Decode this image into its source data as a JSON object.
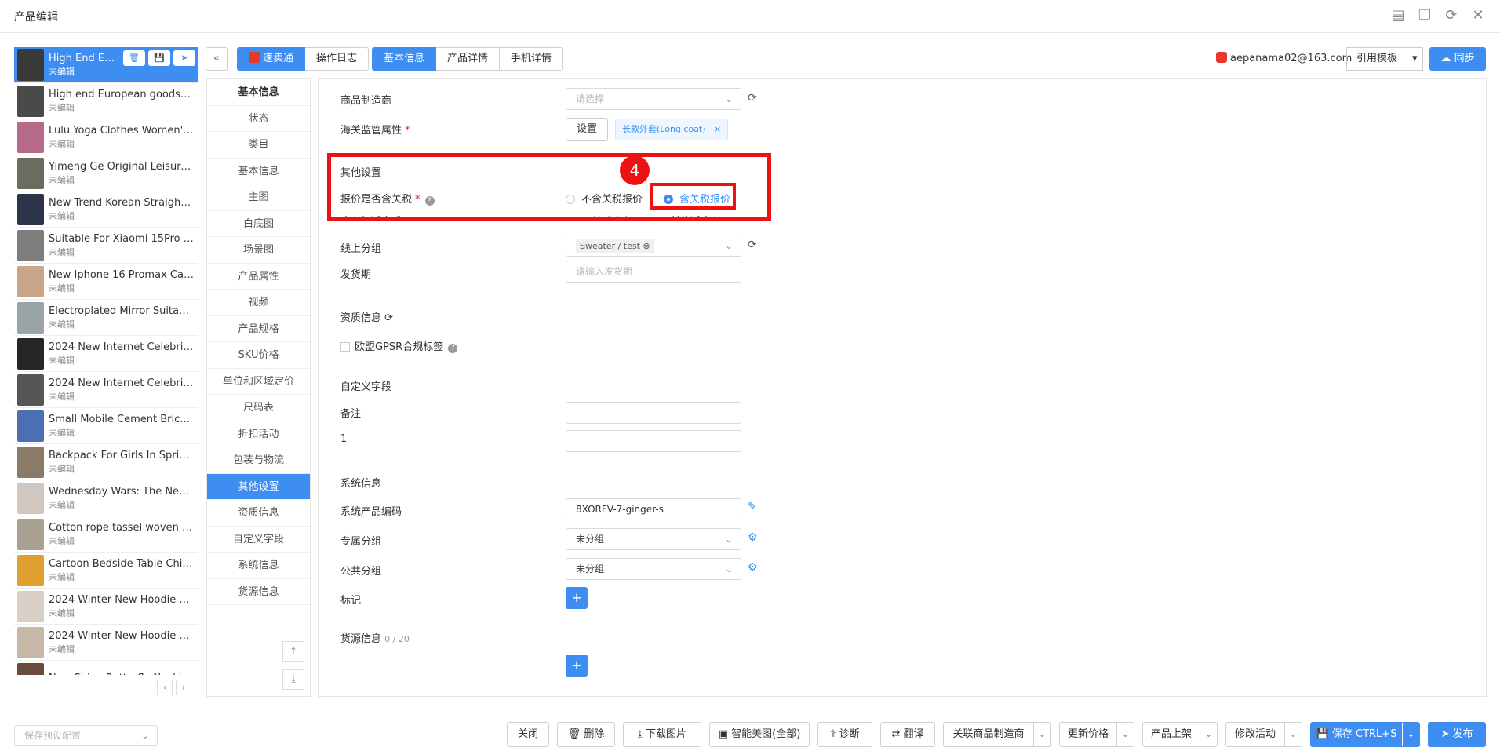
{
  "window": {
    "title": "产品编辑"
  },
  "products": [
    {
      "name": "High End Europ...",
      "status": "未编辑",
      "color": "#3a3a3a"
    },
    {
      "name": "High end European goods, hig...",
      "status": "未编辑",
      "color": "#4a4a4a"
    },
    {
      "name": "Lulu Yoga Clothes Women's S...",
      "status": "未编辑",
      "color": "#b66a8a"
    },
    {
      "name": "Yimeng Ge Original Leisure Ti...",
      "status": "未编辑",
      "color": "#6b6b5f"
    },
    {
      "name": "New Trend Korean Straight Le...",
      "status": "未编辑",
      "color": "#2d3348"
    },
    {
      "name": "Suitable For Xiaomi 15Pro Ph...",
      "status": "未编辑",
      "color": "#7d7d7d"
    },
    {
      "name": "New Iphone 16 Promax Case ...",
      "status": "未编辑",
      "color": "#c9a58a"
    },
    {
      "name": "Electroplated Mirror Suitable F...",
      "status": "未编辑",
      "color": "#9aa3a8"
    },
    {
      "name": "2024 New Internet Celebrity S...",
      "status": "未编辑",
      "color": "#262626"
    },
    {
      "name": "2024 New Internet Celebrity S...",
      "status": "未编辑",
      "color": "#555555"
    },
    {
      "name": "Small Mobile Cement Brick M...",
      "status": "未编辑",
      "color": "#4b6fb0"
    },
    {
      "name": "Backpack For Girls In Spring, ...",
      "status": "未编辑",
      "color": "#8a7a68"
    },
    {
      "name": "Wednesday Wars: The Newbe...",
      "status": "未编辑",
      "color": "#d0c7c0"
    },
    {
      "name": "Cotton rope tassel woven bag,...",
      "status": "未编辑",
      "color": "#a8a090"
    },
    {
      "name": "Cartoon Bedside Table Childre...",
      "status": "未编辑",
      "color": "#e0a030"
    },
    {
      "name": "2024 Winter New Hoodie Loos...",
      "status": "未编辑",
      "color": "#d8cfc6"
    },
    {
      "name": "2024 Winter New Hoodie Loos...",
      "status": "未编辑",
      "color": "#c8b8a8"
    },
    {
      "name": "New Shiny Butterfly Necklace ...",
      "status": "",
      "color": "#6a4a3a"
    }
  ],
  "toolbar": {
    "collapse": "«",
    "platform_tabs": [
      "速卖通",
      "操作日志"
    ],
    "content_tabs": [
      "基本信息",
      "产品详情",
      "手机详情"
    ],
    "account": "aepanama02@163.com",
    "template_label": "引用模板",
    "template_caret": "▾",
    "sync_label": "同步"
  },
  "anchor_nav": {
    "items": [
      "基本信息",
      "状态",
      "类目",
      "基本信息",
      "主图",
      "白底图",
      "场景图",
      "产品属性",
      "视频",
      "产品规格",
      "SKU价格",
      "单位和区域定价",
      "尺码表",
      "折扣活动",
      "包装与物流",
      "其他设置",
      "资质信息",
      "自定义字段",
      "系统信息",
      "货源信息"
    ],
    "to_top": "⤒",
    "to_bottom": "⤓"
  },
  "form": {
    "manufacturer_label": "商品制造商",
    "manufacturer_placeholder": "请选择",
    "customs_label": "海关监管属性",
    "customs_button": "设置",
    "customs_tag": "长款外套(Long coat)",
    "customs_tag_close": "×",
    "other_settings_title": "其他设置",
    "tax_label": "报价是否含关税",
    "tax_option_excl": "不含关税报价",
    "tax_option_incl": "含关税报价",
    "stock_label": "库存扣减方式",
    "stock_option_1": "下单减库存",
    "stock_option_2": "付款减库存",
    "online_group_label": "线上分组",
    "online_group_value": "Sweater / test",
    "ship_label": "发货期",
    "ship_placeholder": "请输入发货期",
    "qualification_title": "资质信息",
    "gpsr_label": "欧盟GPSR合规标签",
    "custom_title": "自定义字段",
    "remark_label": "备注",
    "field1_label": "1",
    "system_title": "系统信息",
    "sys_code_label": "系统产品编码",
    "sys_code_value": "8XORFV-7-ginger-s",
    "private_group_label": "专属分组",
    "private_group_value": "未分组",
    "public_group_label": "公共分组",
    "public_group_value": "未分组",
    "tag_label": "标记",
    "source_title": "货源信息",
    "source_count": "0 / 20",
    "step_number": "4"
  },
  "footer": {
    "preset_placeholder": "保存预设配置",
    "close": "关闭",
    "delete": "删除",
    "download": "下载图片",
    "beautify": "智能美图(全部)",
    "diagnose": "诊断",
    "translate": "翻译",
    "link_maker": "关联商品制造商",
    "update_price": "更新价格",
    "list_product": "产品上架",
    "modify_activity": "修改活动",
    "save": "保存 CTRL+S",
    "publish": "发布"
  },
  "colors": {
    "accent": "#3d8ef0",
    "annotation": "#ee1111",
    "required": "#e02020"
  }
}
